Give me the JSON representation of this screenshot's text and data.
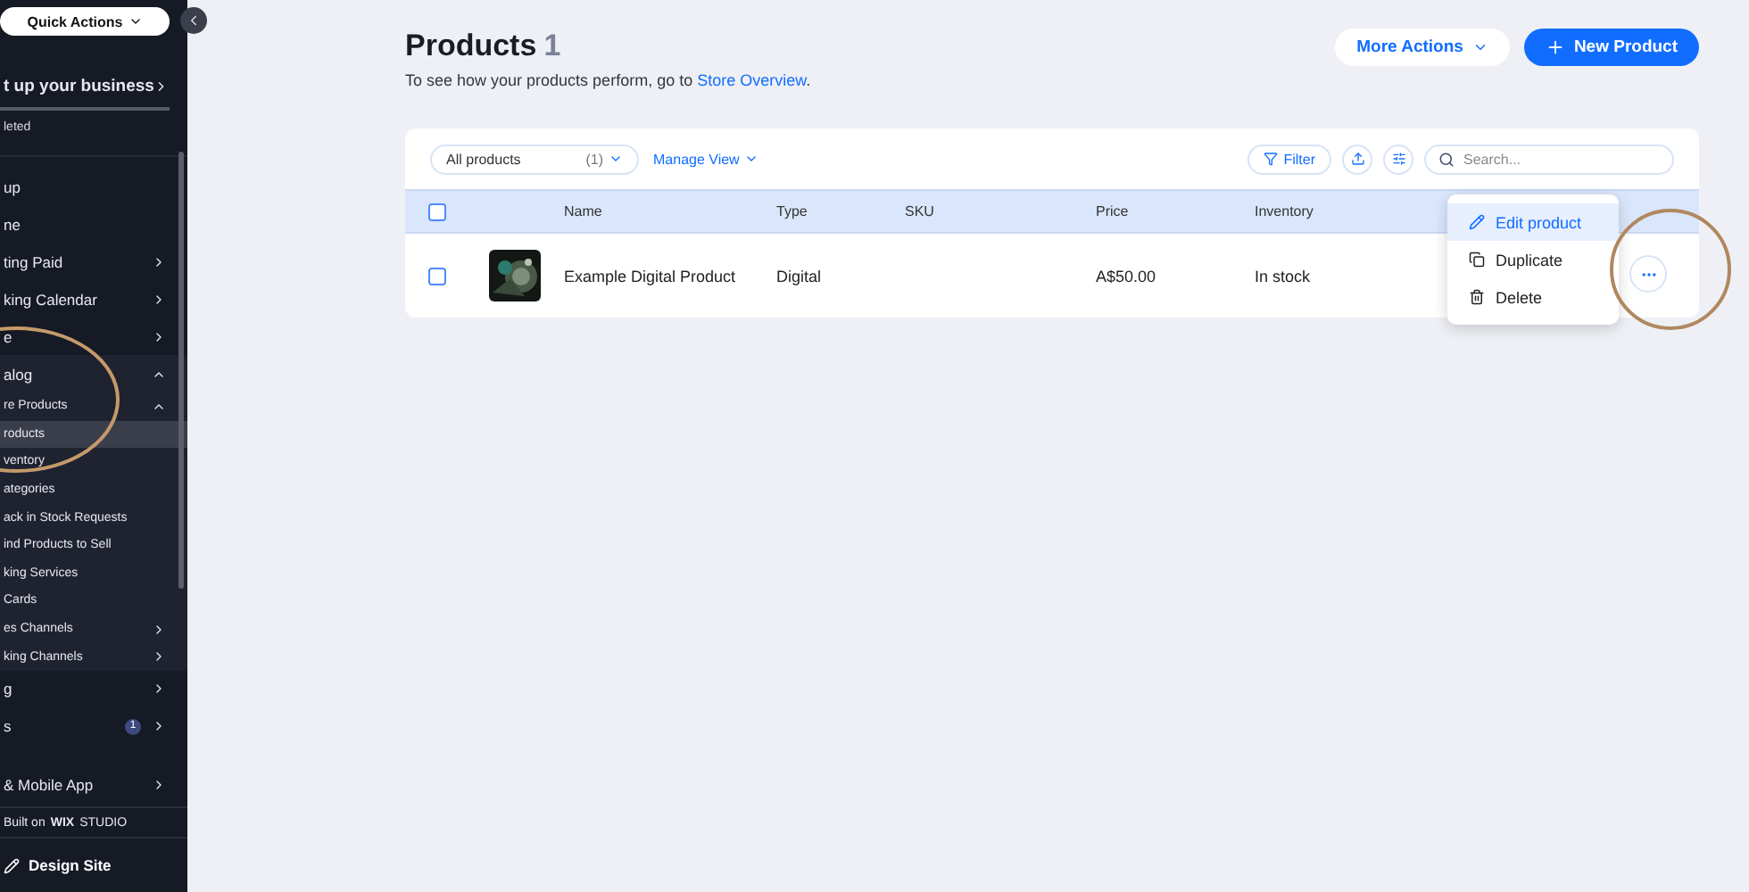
{
  "sidebar": {
    "quick_actions": "Quick Actions",
    "setup": {
      "title": "t up your business",
      "status": "leted"
    },
    "items": [
      {
        "label": "up",
        "has_arrow": false
      },
      {
        "label": "ne",
        "has_arrow": false
      },
      {
        "label": "ting Paid",
        "has_arrow": true
      },
      {
        "label": "king Calendar",
        "has_arrow": true
      },
      {
        "label": "e",
        "has_arrow": true
      },
      {
        "label": "alog",
        "has_arrow": true,
        "expanded": true,
        "children": [
          {
            "label": "re Products",
            "has_arrow": true,
            "expanded": true,
            "children": [
              {
                "label": "roducts",
                "selected": true
              },
              {
                "label": "ventory",
                "selected": false
              },
              {
                "label": "ategories",
                "selected": false
              },
              {
                "label": "ack in Stock Requests",
                "selected": false
              },
              {
                "label": "ind Products to Sell",
                "selected": false
              }
            ]
          },
          {
            "label": "king Services",
            "has_arrow": false
          },
          {
            "label": " Cards",
            "has_arrow": false
          },
          {
            "label": "es Channels",
            "has_arrow": true
          },
          {
            "label": "king Channels",
            "has_arrow": true
          }
        ]
      },
      {
        "label": "g",
        "has_arrow": true
      },
      {
        "label": "s",
        "has_arrow": true,
        "badge": "1"
      }
    ],
    "mobile_app": "& Mobile App",
    "built_on": {
      "prefix": "Built on",
      "brand": "WIX",
      "suffix": "STUDIO"
    },
    "design_site": "Design Site"
  },
  "header": {
    "title": "Products",
    "count": "1",
    "subtitle_prefix": "To see how your products perform, go to ",
    "subtitle_link": "Store Overview",
    "subtitle_suffix": ".",
    "buttons": {
      "more_actions": "More Actions",
      "new_product": "New Product"
    }
  },
  "toolbar": {
    "view": "All products",
    "view_count": "(1)",
    "manage_view": "Manage View",
    "filter": "Filter",
    "search": {
      "placeholder": "Search..."
    }
  },
  "table": {
    "columns": [
      "Name",
      "Type",
      "SKU",
      "Price",
      "Inventory"
    ],
    "rows": [
      {
        "checked": false,
        "cells": [
          "Example Digital Product",
          "Digital",
          "",
          "A$50.00",
          "In stock"
        ]
      }
    ]
  },
  "header_checked": false,
  "row_menu": {
    "items": [
      {
        "label": "Edit product",
        "selected": true
      },
      {
        "label": "Duplicate",
        "selected": false
      },
      {
        "label": "Delete",
        "selected": false
      }
    ]
  }
}
